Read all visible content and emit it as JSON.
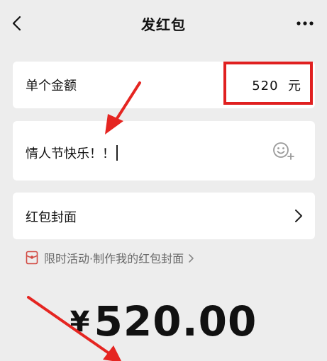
{
  "header": {
    "title": "发红包"
  },
  "amount": {
    "label": "单个金额",
    "value": "520",
    "unit": "元"
  },
  "message": {
    "text": "情人节快乐！！"
  },
  "cover": {
    "label": "红包封面"
  },
  "promo": {
    "text": "限时活动·制作我的红包封面"
  },
  "total": {
    "symbol": "¥",
    "value": "520.00"
  },
  "colors": {
    "background": "#ededed",
    "card": "#ffffff",
    "highlight": "#e02020",
    "promo_text": "#6a6a6a"
  },
  "icons": {
    "back": "chevron-left-icon",
    "more": "more-dots-icon",
    "emoji": "emoji-icon",
    "cover_arrow": "chevron-right-icon",
    "promo": "red-packet-icon"
  }
}
